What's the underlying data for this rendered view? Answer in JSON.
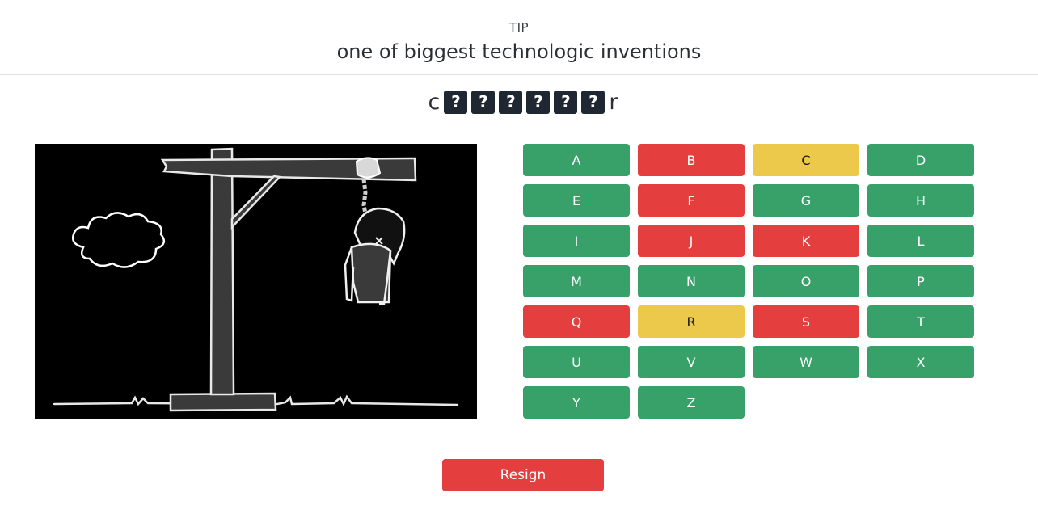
{
  "header": {
    "tip_label": "TIP",
    "tip_text": "one of biggest technologic inventions"
  },
  "word": {
    "slots": [
      {
        "char": "c",
        "revealed": true
      },
      {
        "char": "?",
        "revealed": false
      },
      {
        "char": "?",
        "revealed": false
      },
      {
        "char": "?",
        "revealed": false
      },
      {
        "char": "?",
        "revealed": false
      },
      {
        "char": "?",
        "revealed": false
      },
      {
        "char": "?",
        "revealed": false
      },
      {
        "char": "r",
        "revealed": true
      }
    ]
  },
  "keyboard": {
    "keys": [
      {
        "letter": "A",
        "state": "available"
      },
      {
        "letter": "B",
        "state": "wrong"
      },
      {
        "letter": "C",
        "state": "correct"
      },
      {
        "letter": "D",
        "state": "available"
      },
      {
        "letter": "E",
        "state": "available"
      },
      {
        "letter": "F",
        "state": "wrong"
      },
      {
        "letter": "G",
        "state": "available"
      },
      {
        "letter": "H",
        "state": "available"
      },
      {
        "letter": "I",
        "state": "available"
      },
      {
        "letter": "J",
        "state": "wrong"
      },
      {
        "letter": "K",
        "state": "wrong"
      },
      {
        "letter": "L",
        "state": "available"
      },
      {
        "letter": "M",
        "state": "available"
      },
      {
        "letter": "N",
        "state": "available"
      },
      {
        "letter": "O",
        "state": "available"
      },
      {
        "letter": "P",
        "state": "available"
      },
      {
        "letter": "Q",
        "state": "wrong"
      },
      {
        "letter": "R",
        "state": "correct"
      },
      {
        "letter": "S",
        "state": "wrong"
      },
      {
        "letter": "T",
        "state": "available"
      },
      {
        "letter": "U",
        "state": "available"
      },
      {
        "letter": "V",
        "state": "available"
      },
      {
        "letter": "W",
        "state": "available"
      },
      {
        "letter": "X",
        "state": "available"
      },
      {
        "letter": "Y",
        "state": "available"
      },
      {
        "letter": "Z",
        "state": "available"
      }
    ]
  },
  "colors": {
    "available": "#38a169",
    "wrong": "#e53e3e",
    "correct": "#ecc94b",
    "hidden_tile": "#1f2733"
  },
  "actions": {
    "resign_label": "Resign"
  }
}
